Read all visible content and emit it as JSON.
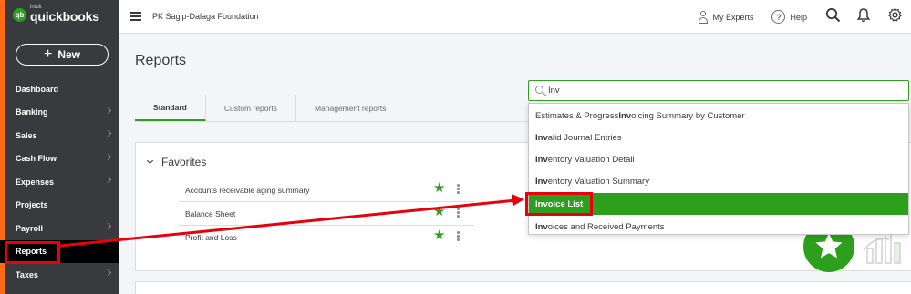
{
  "brand": {
    "small": "intuit",
    "name": "quickbooks",
    "logo_glyph": "qb"
  },
  "sidebar": {
    "new_label": "New",
    "new_icon": "+",
    "items": [
      {
        "label": "Dashboard",
        "chevron": false
      },
      {
        "label": "Banking",
        "chevron": true
      },
      {
        "label": "Sales",
        "chevron": true
      },
      {
        "label": "Cash Flow",
        "chevron": true
      },
      {
        "label": "Expenses",
        "chevron": true
      },
      {
        "label": "Projects",
        "chevron": false
      },
      {
        "label": "Payroll",
        "chevron": true
      },
      {
        "label": "Reports",
        "chevron": false,
        "active": true
      },
      {
        "label": "Taxes",
        "chevron": true
      }
    ]
  },
  "header": {
    "company": "PK Sagip-Dalaga Foundation",
    "my_experts": "My Experts",
    "help": "Help",
    "help_glyph": "?"
  },
  "page": {
    "title": "Reports"
  },
  "tabs": [
    {
      "label": "Standard",
      "active": true
    },
    {
      "label": "Custom reports"
    },
    {
      "label": "Management reports"
    }
  ],
  "search": {
    "value": "Inv"
  },
  "dropdown": [
    {
      "match": "",
      "prefix": "Estimates & Progress ",
      "bold": "Inv",
      "rest": "oicing Summary by Customer"
    },
    {
      "prefix": "",
      "bold": "Inv",
      "rest": "alid Journal Entries"
    },
    {
      "prefix": "",
      "bold": "Inv",
      "rest": "entory Valuation Detail"
    },
    {
      "prefix": "",
      "bold": "Inv",
      "rest": "entory Valuation Summary"
    },
    {
      "prefix": "",
      "bold": "Invoice List",
      "rest": "",
      "highlighted": true
    },
    {
      "prefix": "",
      "bold": "Inv",
      "rest": "oices and Received Payments"
    }
  ],
  "favorites": {
    "title": "Favorites",
    "reports": [
      {
        "name": "Accounts receivable aging summary"
      },
      {
        "name": "Balance Sheet"
      },
      {
        "name": "Profit and Loss"
      }
    ]
  },
  "colors": {
    "brand_green": "#2ca01c",
    "sidebar_bg": "#393a3d",
    "annotation_red": "#e8000b"
  }
}
